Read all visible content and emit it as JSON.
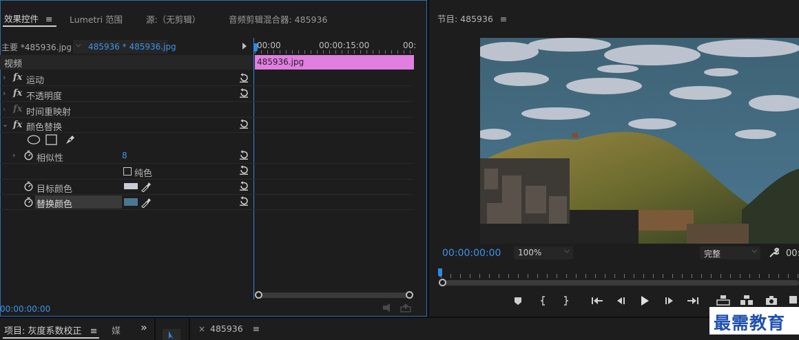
{
  "effect_panel": {
    "tabs": [
      "效果控件",
      "Lumetri 范围",
      "源:（无剪辑）",
      "音频剪辑混合器: 485936"
    ],
    "menu_glyph": "≡",
    "master_label": "主要 *485936.jpg",
    "clip_label": "485936 * 485936.jpg",
    "timecodes": [
      "00:00",
      "00:00:15:00",
      "00:"
    ],
    "clip_bar_label": "485936.jpg",
    "section_label": "视频",
    "effects": [
      "运动",
      "不透明度",
      "时间重映射",
      "颜色替换"
    ],
    "fx_glyph": "fx",
    "similarity_label": "相似性",
    "similarity_value": "8",
    "solid_label": "纯色",
    "target_color_label": "目标颜色",
    "replace_color_label": "替换颜色",
    "target_color": "#c8ccd6",
    "replace_color": "#4b7791",
    "footer_timecode": "00:00:00:00"
  },
  "program_monitor": {
    "title": "节目: 485936",
    "menu_glyph": "≡",
    "timecode": "00:00:00:00",
    "zoom_value": "100%",
    "quality_value": "完整",
    "right_timecode": "00:"
  },
  "bottom_bar": {
    "project_tab": "项目: 灰度系数校正",
    "media_tab": "媒",
    "expand_glyph": "»",
    "close_glyph": "×",
    "sequence_tab": "485936",
    "menu_glyph": "≡"
  },
  "watermark": {
    "text": "最需教育"
  },
  "colors": {
    "accent": "#2e8ae6",
    "clip_bar": "#e07fe0",
    "panel_bg": "#1d1d1d"
  }
}
